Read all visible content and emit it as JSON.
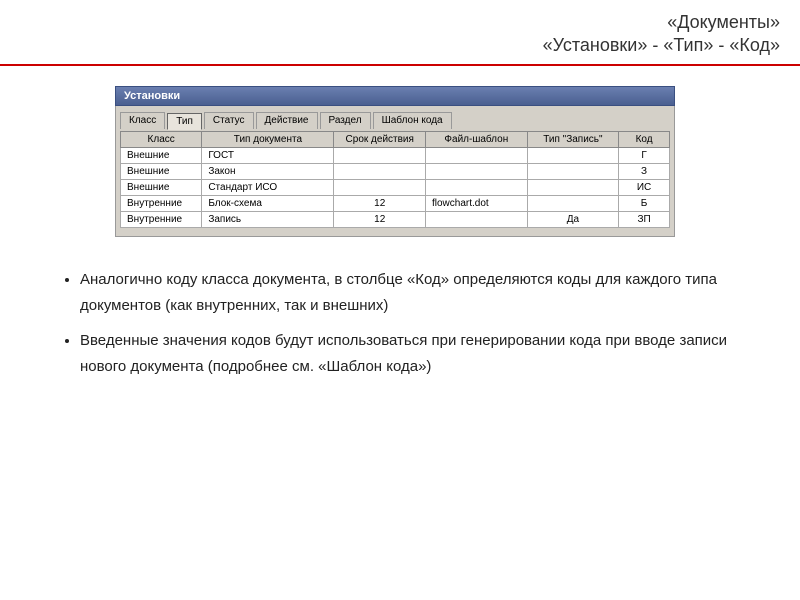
{
  "header": {
    "title": "«Документы»",
    "subtitle": "«Установки» - «Тип» - «Код»"
  },
  "window": {
    "title": "Установки",
    "tabs": [
      "Класс",
      "Тип",
      "Статус",
      "Действие",
      "Раздел",
      "Шаблон кода"
    ],
    "active_tab": 1,
    "columns": [
      "Класс",
      "Тип документа",
      "Срок действия",
      "Файл-шаблон",
      "Тип \"Запись\"",
      "Код"
    ],
    "rows": [
      {
        "class": "Внешние",
        "doctype": "ГОСТ",
        "term": "",
        "template": "",
        "record": "",
        "code": "Г"
      },
      {
        "class": "Внешние",
        "doctype": "Закон",
        "term": "",
        "template": "",
        "record": "",
        "code": "З"
      },
      {
        "class": "Внешние",
        "doctype": "Стандарт ИСО",
        "term": "",
        "template": "",
        "record": "",
        "code": "ИС"
      },
      {
        "class": "Внутренние",
        "doctype": "Блок-схема",
        "term": "12",
        "template": "flowchart.dot",
        "record": "",
        "code": "Б"
      },
      {
        "class": "Внутренние",
        "doctype": "Запись",
        "term": "12",
        "template": "",
        "record": "Да",
        "code": "ЗП"
      }
    ]
  },
  "bullets": [
    "Аналогично коду класса документа, в столбце «Код» определяются коды для каждого типа документов (как внутренних, так и внешних)",
    "Введенные значения кодов будут использоваться при генерировании кода при вводе записи нового документа (подробнее см. «Шаблон кода»)"
  ]
}
